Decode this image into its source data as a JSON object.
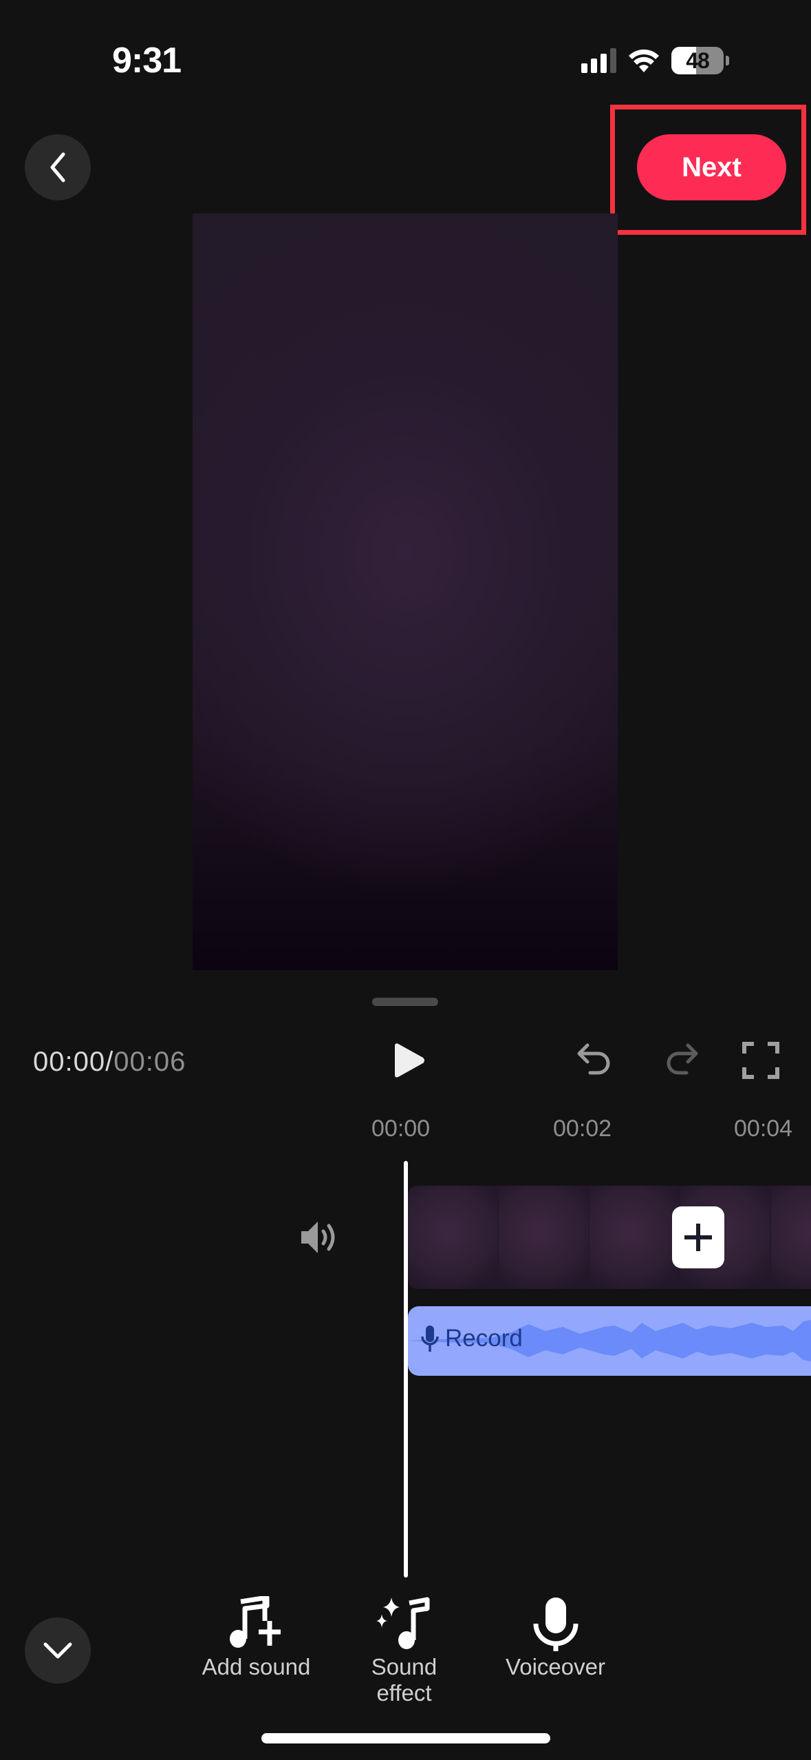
{
  "status_bar": {
    "time": "9:31",
    "battery_percent": "48",
    "icons": [
      "signal-icon",
      "wifi-icon",
      "battery-icon"
    ]
  },
  "top_bar": {
    "back_icon": "chevron-left-icon",
    "next_label": "Next",
    "accent_color": "#FE2C55",
    "highlight_color": "#F5333F"
  },
  "playback": {
    "current_time": "00:00",
    "separator": "/",
    "total_time": "00:06",
    "play_icon": "play-icon",
    "undo_icon": "undo-icon",
    "redo_icon": "redo-icon",
    "fullscreen_icon": "fullscreen-icon"
  },
  "ruler": {
    "ticks": [
      "00:00",
      "00:02",
      "00:04"
    ]
  },
  "timeline": {
    "volume_icon": "speaker-icon",
    "add_clip_icon": "plus-icon",
    "audio_track": {
      "label": "Record",
      "icon": "microphone-icon",
      "track_color": "#93A8FC",
      "wave_color": "#6A8BF9",
      "text_color": "#1E3A8A"
    }
  },
  "bottom_toolbar": {
    "collapse_icon": "chevron-down-icon",
    "tools": [
      {
        "label": "Add sound",
        "icon": "music-note-plus-icon"
      },
      {
        "label": "Sound\neffect",
        "icon": "music-note-sparkle-icon"
      },
      {
        "label": "Voiceover",
        "icon": "microphone-icon"
      }
    ]
  }
}
